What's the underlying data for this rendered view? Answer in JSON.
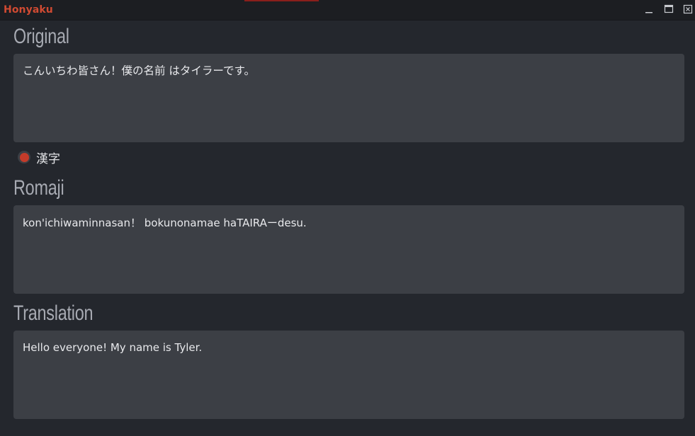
{
  "window": {
    "title": "Honyaku",
    "controls": {
      "minimize_icon": "minimize-icon",
      "maximize_icon": "maximize-icon",
      "close_icon": "close-icon"
    }
  },
  "colors": {
    "accent": "#d04a32",
    "background": "#24272d",
    "field": "#3c3f45",
    "label": "#a7aab2"
  },
  "original": {
    "label": "Original",
    "text": "こんいちわ皆さん！僕の名前 はタイラーです。"
  },
  "script_option": {
    "label": "漢字",
    "selected": true
  },
  "romaji": {
    "label": "Romaji",
    "text": "kon'ichiwaminnasan！ bokunonamae haTAIRAーdesu."
  },
  "translation": {
    "label": "Translation",
    "text": "Hello everyone! My name is Tyler."
  }
}
